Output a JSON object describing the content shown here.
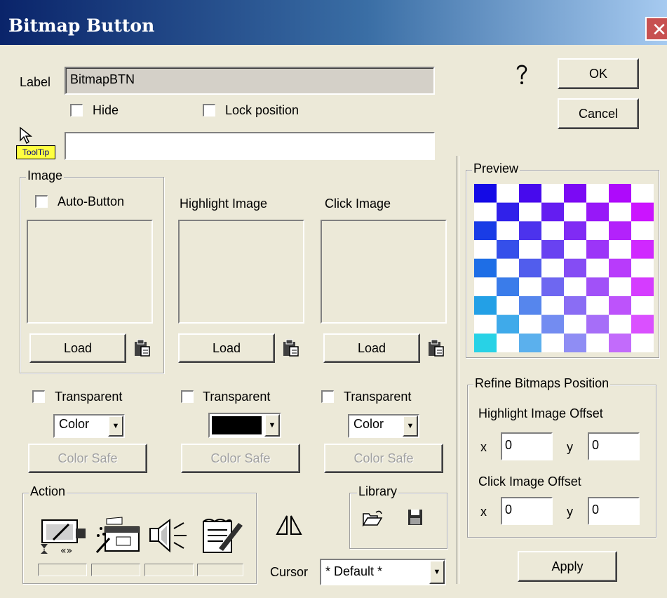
{
  "window": {
    "title": "Bitmap Button",
    "close_glyph": "✕"
  },
  "label_field": {
    "caption": "Label",
    "value": "BitmapBTN"
  },
  "hide_checkbox": {
    "label": "Hide",
    "checked": false
  },
  "lock_checkbox": {
    "label": "Lock position",
    "checked": false
  },
  "tooltip": {
    "badge": "ToolTip",
    "value": ""
  },
  "help_icon": "help-icon",
  "ok_button": {
    "label": "OK"
  },
  "cancel_button": {
    "label": "Cancel"
  },
  "image_group": {
    "title": "Image",
    "auto_button": {
      "label": "Auto-Button",
      "checked": false
    },
    "load_label": "Load"
  },
  "highlight": {
    "title": "Highlight Image",
    "load_label": "Load"
  },
  "click": {
    "title": "Click Image",
    "load_label": "Load"
  },
  "transparent": [
    {
      "label": "Transparent",
      "checked": false,
      "combo_value": "Color",
      "color_safe": "Color Safe"
    },
    {
      "label": "Transparent",
      "checked": false,
      "combo_value": "",
      "combo_color": "#000000",
      "color_safe": "Color Safe"
    },
    {
      "label": "Transparent",
      "checked": false,
      "combo_value": "Color",
      "color_safe": "Color Safe"
    }
  ],
  "preview": {
    "title": "Preview"
  },
  "refine": {
    "title": "Refine Bitmaps Position",
    "highlight_offset_label": "Highlight Image Offset",
    "click_offset_label": "Click Image Offset",
    "x_label": "x",
    "y_label": "y",
    "highlight_x": "0",
    "highlight_y": "0",
    "click_x": "0",
    "click_y": "0"
  },
  "apply_button": {
    "label": "Apply"
  },
  "action_group": {
    "title": "Action"
  },
  "library_group": {
    "title": "Library"
  },
  "cursor": {
    "label": "Cursor",
    "value": "* Default *"
  },
  "colors": {
    "title_bar_start": "#0a246a",
    "dialog_bg": "#ece9d8",
    "close_red": "#c75050",
    "tooltip_badge": "#ffff40"
  }
}
